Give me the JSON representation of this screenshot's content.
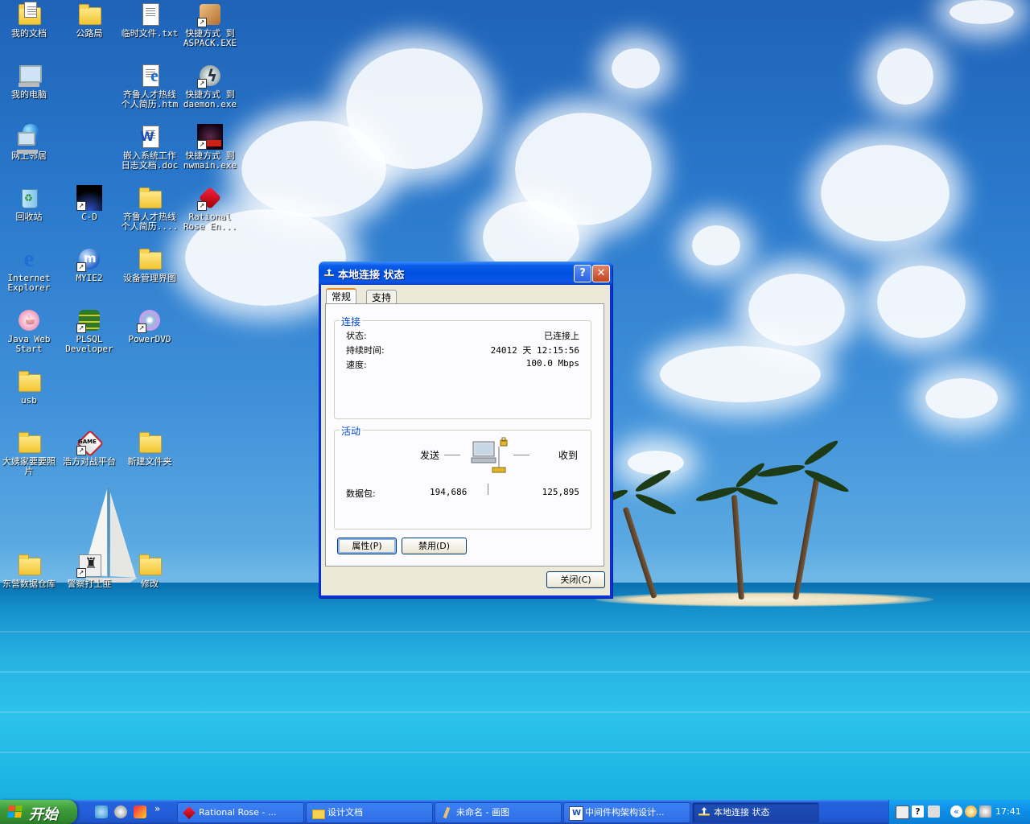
{
  "desktop": {
    "icons": [
      {
        "label": "我的文档"
      },
      {
        "label": "公路局"
      },
      {
        "label": "临时文件.txt"
      },
      {
        "label": "快捷方式 到\nASPACK.EXE"
      },
      {
        "label": "我的电脑"
      },
      {
        "label": "齐鲁人才热线\n个人简历.htm"
      },
      {
        "label": "快捷方式 到\ndaemon.exe"
      },
      {
        "label": "网上邻居"
      },
      {
        "label": "嵌入系统工作\n日志文档.doc"
      },
      {
        "label": "快捷方式 到\nnwmain.exe"
      },
      {
        "label": "回收站"
      },
      {
        "label": "C-D"
      },
      {
        "label": "齐鲁人才热线\n个人简历...."
      },
      {
        "label": "Rational\nRose En..."
      },
      {
        "label": "Internet\nExplorer"
      },
      {
        "label": "MYIE2"
      },
      {
        "label": "设备管理界图"
      },
      {
        "label": "Java Web\nStart"
      },
      {
        "label": "PLSQL\nDeveloper"
      },
      {
        "label": "PowerDVD"
      },
      {
        "label": "usb"
      },
      {
        "label": "大姨家要要照\n片"
      },
      {
        "label": "浩方对战平台"
      },
      {
        "label": "新建文件夹"
      },
      {
        "label": "东营数据仓库"
      },
      {
        "label": "警察打土匪"
      },
      {
        "label": "修改"
      }
    ]
  },
  "dialog": {
    "title": "本地连接 状态",
    "help_glyph": "?",
    "close_glyph": "✕",
    "tabs": [
      {
        "label": "常规"
      },
      {
        "label": "支持"
      }
    ],
    "connection": {
      "group_title": "连接",
      "status_label": "状态:",
      "status_value": "已连接上",
      "duration_label": "持续时间:",
      "duration_value": "24012 天 12:15:56",
      "speed_label": "速度:",
      "speed_value": "100.0 Mbps"
    },
    "activity": {
      "group_title": "活动",
      "sent_label": "发送",
      "received_label": "收到",
      "packets_label": "数据包:",
      "packets_sent": "194,686",
      "packets_received": "125,895"
    },
    "properties_button": "属性(P)",
    "disable_button": "禁用(D)",
    "close_button": "关闭(C)"
  },
  "taskbar": {
    "start_label": "开始",
    "overflow_glyph": "»",
    "tasks": [
      {
        "label": "Rational Rose - ..."
      },
      {
        "label": "设计文档"
      },
      {
        "label": "未命名 - 画图"
      },
      {
        "label": "中间件构架构设计..."
      },
      {
        "label": "本地连接 状态"
      }
    ],
    "tray_expand": "«",
    "clock": "17:41"
  }
}
